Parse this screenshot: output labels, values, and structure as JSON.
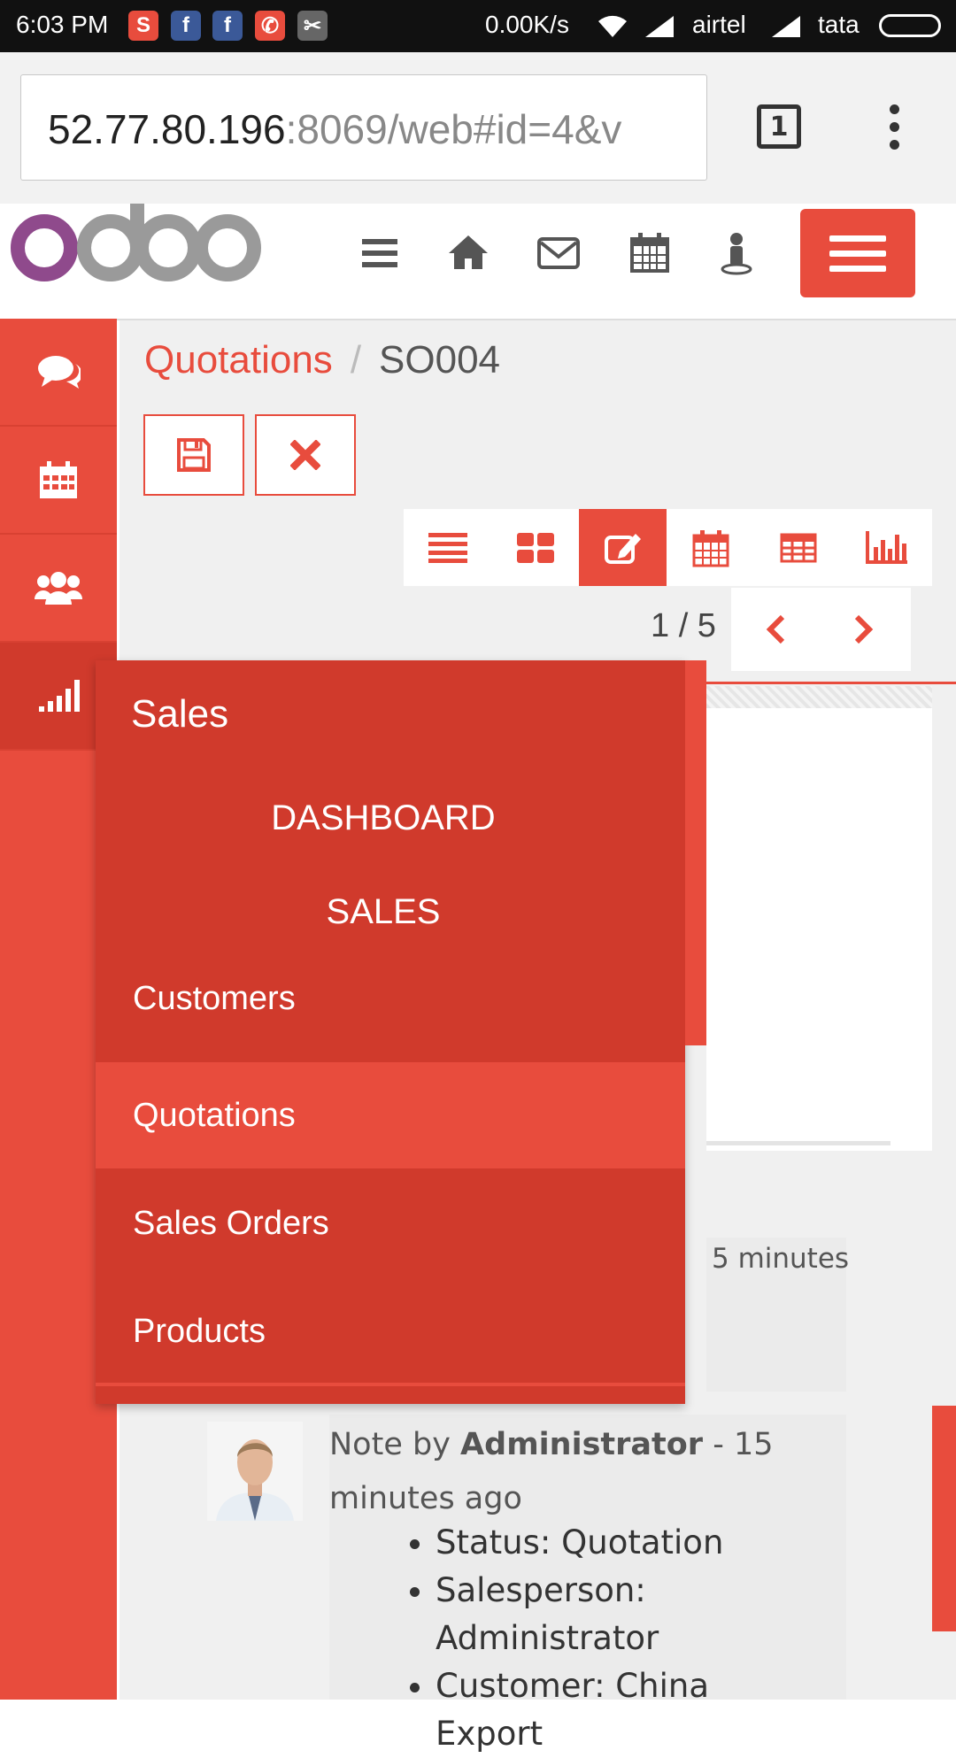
{
  "status_bar": {
    "time": "6:03 PM",
    "speed": "0.00K/s",
    "carrier1": "airtel",
    "carrier2": "tata",
    "apps": [
      {
        "icon": "skype-icon",
        "glyph": "S",
        "color": "#e84c3d"
      },
      {
        "icon": "facebook-icon",
        "glyph": "f",
        "color": "#3b5998"
      },
      {
        "icon": "facebook-icon",
        "glyph": "f",
        "color": "#3b5998"
      },
      {
        "icon": "whatsapp-icon",
        "glyph": "✆",
        "color": "#e84c3d"
      },
      {
        "icon": "app-icon",
        "glyph": "✂",
        "color": "#666666"
      }
    ]
  },
  "browser": {
    "url_host": "52.77.80.196",
    "url_rest": ":8069/web#id=4&v",
    "tab_count": "1"
  },
  "header": {
    "logo": "odoo",
    "icons": [
      "menu-icon",
      "home-icon",
      "mail-icon",
      "calendar-icon",
      "user-icon"
    ]
  },
  "sidebar": {
    "items": [
      "chat-icon",
      "calendar-icon",
      "users-icon",
      "sales-icon"
    ]
  },
  "breadcrumb": {
    "parent": "Quotations",
    "separator": "/",
    "current": "SO004"
  },
  "actions": {
    "save": "save-icon",
    "discard": "discard-icon"
  },
  "view_switcher": [
    "list-icon",
    "kanban-icon",
    "form-icon",
    "calendar-icon",
    "pivot-icon",
    "graph-icon"
  ],
  "pager": {
    "text": "1 / 5"
  },
  "chatter": {
    "msg1_fragment": "5 minutes",
    "msg2": {
      "prefix": "Note by ",
      "author": "Administrator",
      "time": " - 15 minutes ago",
      "lines": [
        "Status: Quotation",
        "Salesperson: Administrator",
        "Customer: China Export"
      ]
    }
  },
  "menu": {
    "title": "Sales",
    "headers": [
      "DASHBOARD",
      "SALES"
    ],
    "items": [
      "Customers",
      "Quotations",
      "Sales Orders",
      "Products"
    ],
    "active_item": "Quotations"
  },
  "colors": {
    "accent": "#e84c3d",
    "accent_dark": "#d03a2c"
  }
}
